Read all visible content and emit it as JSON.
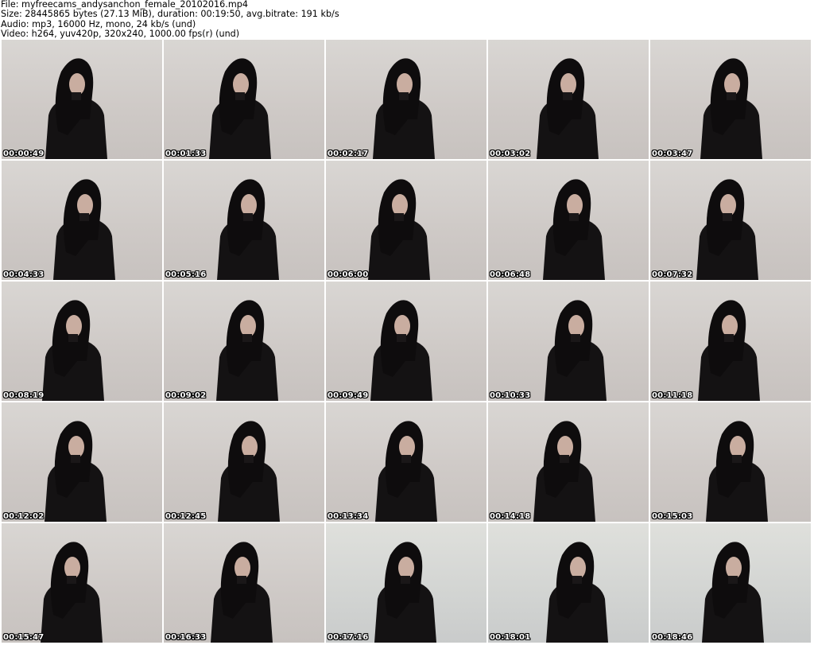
{
  "header": {
    "file_line": "File: myfreecams_andysanchon_female_20102016.mp4",
    "size_line": "Size: 28445865 bytes (27.13 MiB), duration: 00:19:50, avg.bitrate: 191 kb/s",
    "audio_line": "Audio: mp3, 16000 Hz, mono, 24 kb/s (und)",
    "video_line": "Video: h264, yuv420p, 320x240, 1000.00 fps(r) (und)"
  },
  "thumbnails": [
    {
      "timestamp": "00:00:49"
    },
    {
      "timestamp": "00:01:33"
    },
    {
      "timestamp": "00:02:17"
    },
    {
      "timestamp": "00:03:02"
    },
    {
      "timestamp": "00:03:47"
    },
    {
      "timestamp": "00:04:33"
    },
    {
      "timestamp": "00:05:16"
    },
    {
      "timestamp": "00:06:00"
    },
    {
      "timestamp": "00:06:48"
    },
    {
      "timestamp": "00:07:32"
    },
    {
      "timestamp": "00:08:19"
    },
    {
      "timestamp": "00:09:02"
    },
    {
      "timestamp": "00:09:49"
    },
    {
      "timestamp": "00:10:33"
    },
    {
      "timestamp": "00:11:18"
    },
    {
      "timestamp": "00:12:02"
    },
    {
      "timestamp": "00:12:45"
    },
    {
      "timestamp": "00:13:34"
    },
    {
      "timestamp": "00:14:18"
    },
    {
      "timestamp": "00:15:03"
    },
    {
      "timestamp": "00:15:47"
    },
    {
      "timestamp": "00:16:33"
    },
    {
      "timestamp": "00:17:16"
    },
    {
      "timestamp": "00:18:01"
    },
    {
      "timestamp": "00:18:46"
    }
  ]
}
